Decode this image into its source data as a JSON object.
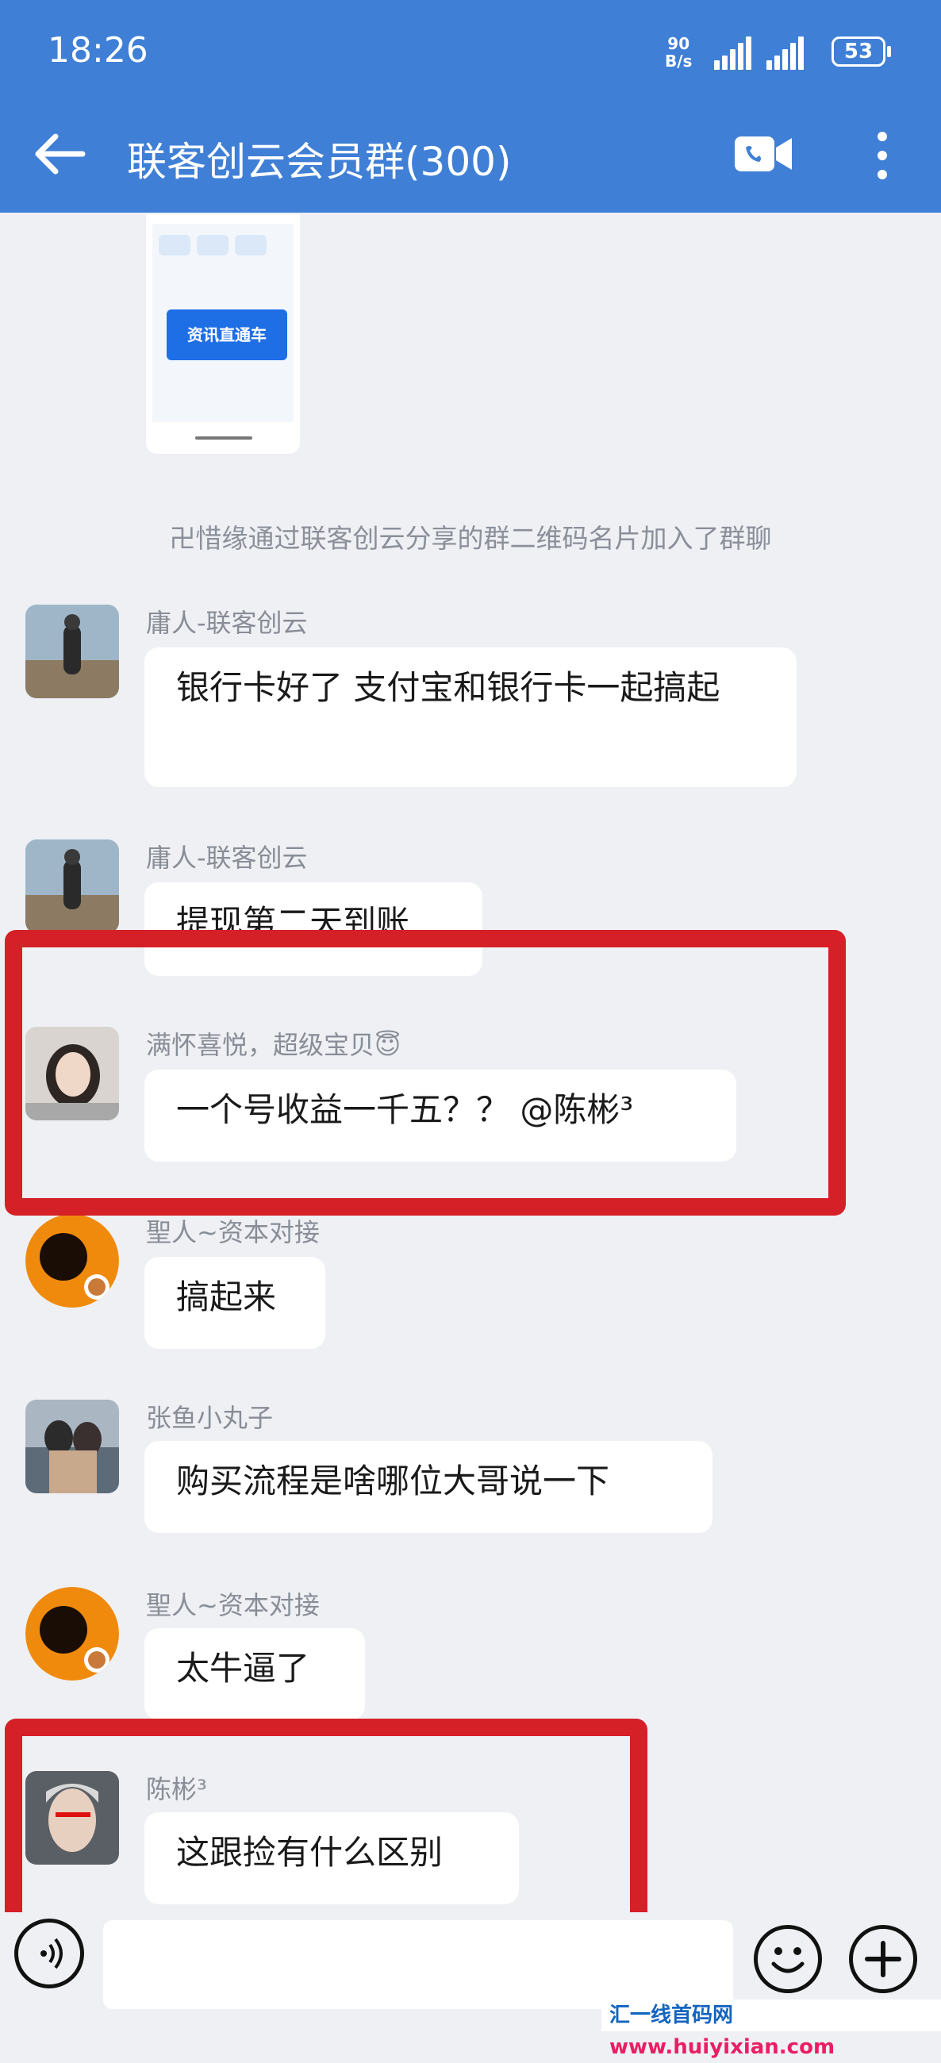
{
  "status_bar": {
    "time": "18:26",
    "net_speed_value": "90",
    "net_speed_unit": "B/s",
    "battery": "53"
  },
  "header": {
    "title": "联客创云会员群(300)",
    "back_icon": "back-arrow-icon",
    "video_icon": "video-call-icon",
    "more_icon": "more-vertical-icon"
  },
  "shared_card": {
    "banner_text": "资讯直通车"
  },
  "system_message": "卍惜缘通过联客创云分享的群二维码名片加入了群聊",
  "messages": [
    {
      "sender": "庸人-联客创云",
      "text": "银行卡好了 支付宝和银行卡一起搞起"
    },
    {
      "sender": "庸人-联客创云",
      "text": "提现第二天到账"
    },
    {
      "sender": "满怀喜悦，超级宝贝😇",
      "text": "一个号收益一千五？？ @陈彬³"
    },
    {
      "sender": "聖人~资本对接",
      "text": "搞起来"
    },
    {
      "sender": "张鱼小丸子",
      "text": "购买流程是啥哪位大哥说一下"
    },
    {
      "sender": "聖人~资本对接",
      "text": "太牛逼了"
    },
    {
      "sender": "陈彬³",
      "text": "这跟捡有什么区别"
    }
  ],
  "input_bar": {
    "voice_icon": "voice-icon",
    "emoji_icon": "emoji-icon",
    "plus_icon": "plus-icon",
    "placeholder": ""
  },
  "site_badge": {
    "part1": "汇一线首码网",
    "part2": "www.huiyixian.com"
  },
  "colors": {
    "header": "#3f7fd6",
    "background": "#eef0f4",
    "highlight_box": "#d42026"
  }
}
